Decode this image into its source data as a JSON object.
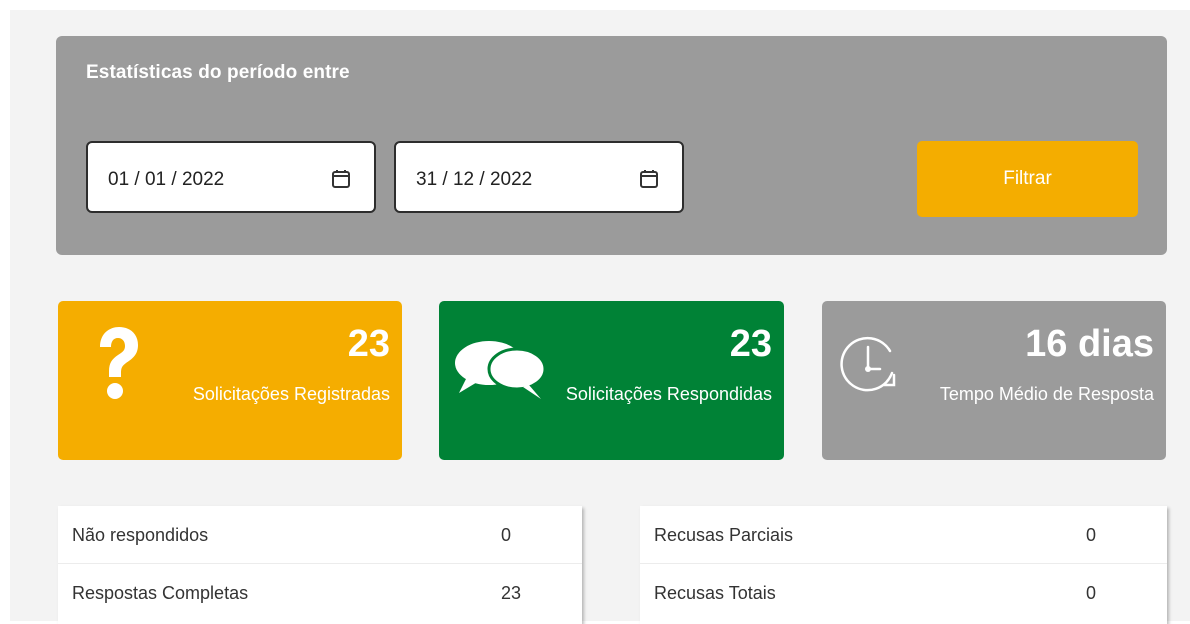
{
  "filter": {
    "title": "Estatísticas do período entre",
    "start_date": "01 / 01 / 2022",
    "end_date": "31 / 12 / 2022",
    "button_label": "Filtrar",
    "calendar_icon": "calendar-icon"
  },
  "cards": [
    {
      "value": "23",
      "label": "Solicitações Registradas",
      "icon": "question-icon",
      "color": "#f5ad00"
    },
    {
      "value": "23",
      "label": "Solicitações Respondidas",
      "icon": "chat-bubbles-icon",
      "color": "#008236"
    },
    {
      "value": "16 dias",
      "label": "Tempo Médio de Resposta",
      "icon": "clock-icon",
      "color": "#9b9b9b"
    }
  ],
  "tables": {
    "left": [
      {
        "label": "Não respondidos",
        "value": "0"
      },
      {
        "label": "Respostas Completas",
        "value": "23"
      }
    ],
    "right": [
      {
        "label": "Recusas Parciais",
        "value": "0"
      },
      {
        "label": "Recusas Totais",
        "value": "0"
      }
    ]
  },
  "colors": {
    "accent": "#f4ad00",
    "success": "#008236",
    "neutral": "#9b9b9b",
    "background": "#f3f3f3"
  }
}
